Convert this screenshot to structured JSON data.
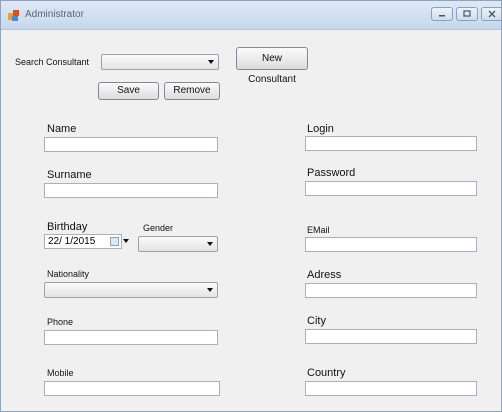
{
  "window": {
    "title": "Administrator"
  },
  "search": {
    "label": "Search Consultant",
    "value": ""
  },
  "buttons": {
    "new_consultant": "New Consultant",
    "save": "Save",
    "remove": "Remove"
  },
  "fields": {
    "name": {
      "label": "Name",
      "value": ""
    },
    "surname": {
      "label": "Surname",
      "value": ""
    },
    "birthday": {
      "label": "Birthday",
      "value": "22/ 1/2015"
    },
    "gender": {
      "label": "Gender",
      "value": ""
    },
    "nationality": {
      "label": "Nationality",
      "value": ""
    },
    "phone": {
      "label": "Phone",
      "value": ""
    },
    "mobile": {
      "label": "Mobile",
      "value": ""
    },
    "login": {
      "label": "Login",
      "value": ""
    },
    "password": {
      "label": "Password",
      "value": ""
    },
    "email": {
      "label": "EMail",
      "value": ""
    },
    "adress": {
      "label": "Adress",
      "value": ""
    },
    "city": {
      "label": "City",
      "value": ""
    },
    "country": {
      "label": "Country",
      "value": ""
    }
  },
  "icons": {
    "app": "app-icon",
    "minimize": "minimize-icon",
    "maximize": "maximize-icon",
    "close": "close-icon"
  }
}
